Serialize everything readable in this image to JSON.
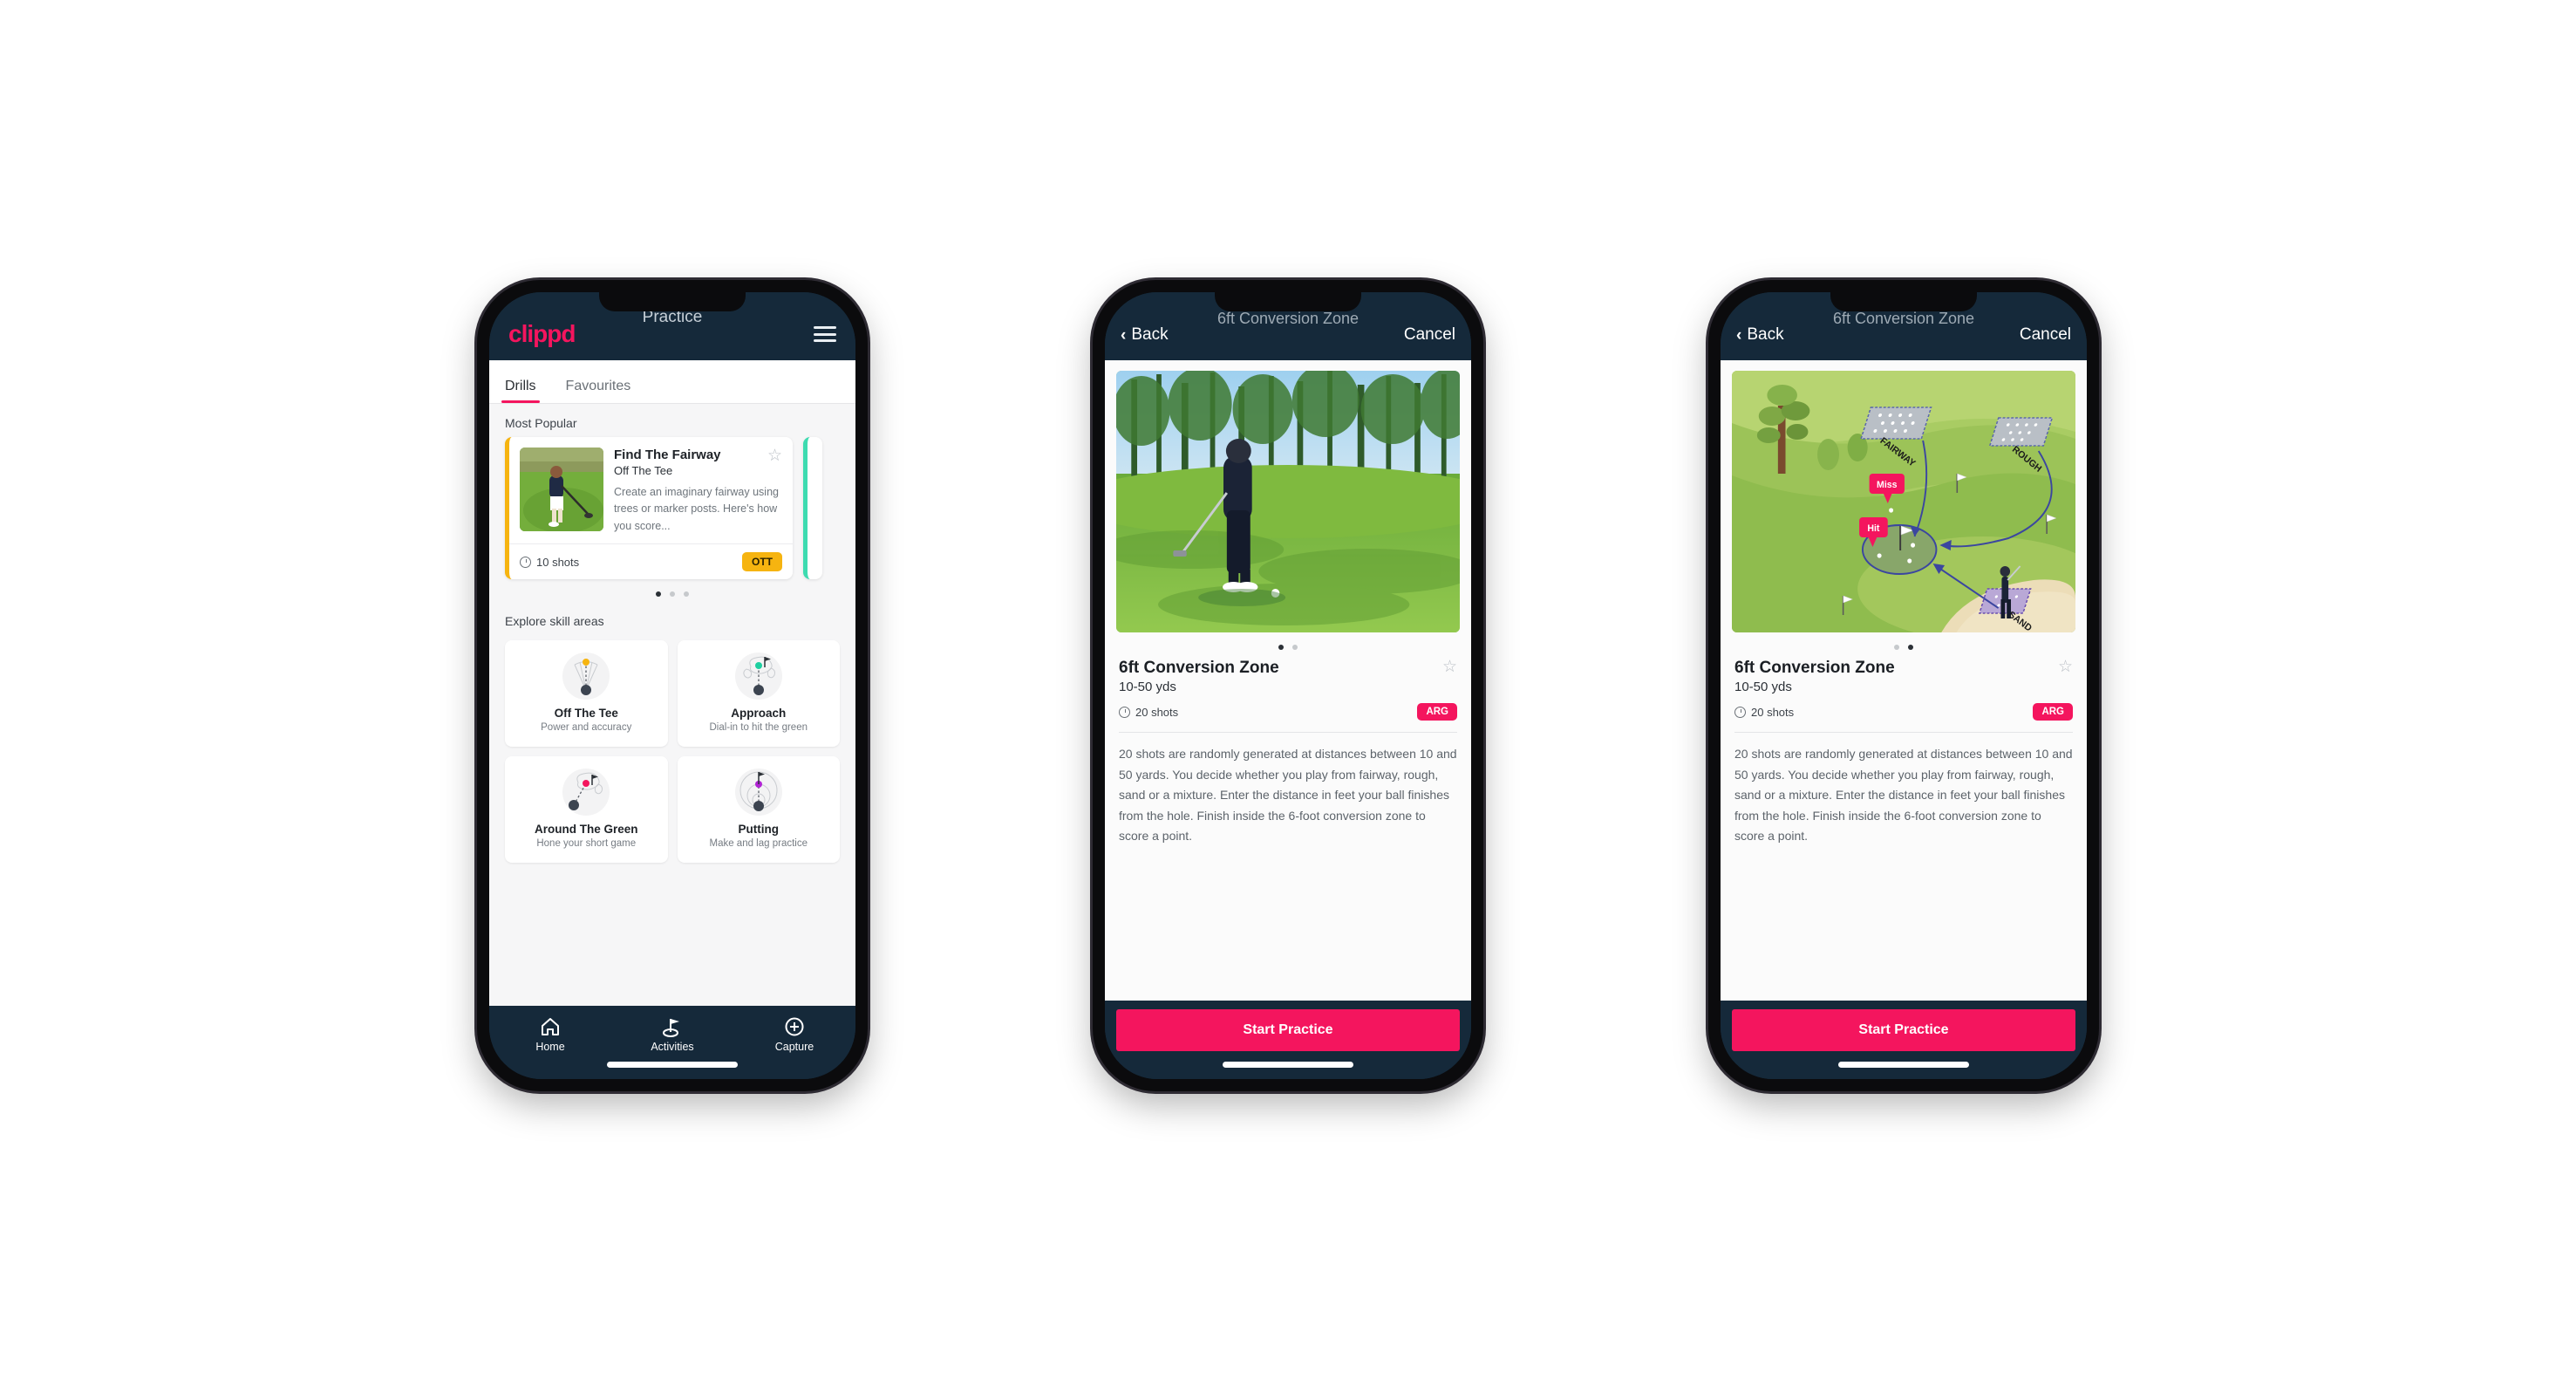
{
  "app": {
    "brand": "clippd",
    "accent_pink": "#f4155e",
    "dark_navy": "#15293a",
    "ott_yellow": "#f6b410",
    "teal": "#3ddbb0"
  },
  "phone1": {
    "appbar": {
      "title": "Practice",
      "menu_icon": "hamburger-icon"
    },
    "tabs": [
      {
        "label": "Drills",
        "active": true
      },
      {
        "label": "Favourites",
        "active": false
      }
    ],
    "sections": {
      "most_popular": "Most Popular",
      "explore": "Explore skill areas"
    },
    "drill_card": {
      "name": "Find The Fairway",
      "category": "Off The Tee",
      "description": "Create an imaginary fairway using trees or marker posts. Here's how you score...",
      "shots": "10 shots",
      "badge": "OTT",
      "star_icon": "star-outline-icon",
      "accent": "#f6b410"
    },
    "carousel_dots": [
      true,
      false,
      false
    ],
    "skills": [
      {
        "name": "Off The Tee",
        "desc": "Power and accuracy",
        "icon": "off-the-tee-icon",
        "dot": "#f6b410"
      },
      {
        "name": "Approach",
        "desc": "Dial-in to hit the green",
        "icon": "approach-icon",
        "dot": "#1ecfa0"
      },
      {
        "name": "Around The Green",
        "desc": "Hone your short game",
        "icon": "around-the-green-icon",
        "dot": "#f4155e"
      },
      {
        "name": "Putting",
        "desc": "Make and lag practice",
        "icon": "putting-icon",
        "dot": "#b124d4"
      }
    ],
    "tabbar": [
      {
        "label": "Home",
        "icon": "home-icon",
        "active": false
      },
      {
        "label": "Activities",
        "icon": "golf-flag-icon",
        "active": true
      },
      {
        "label": "Capture",
        "icon": "plus-circle-icon",
        "active": false
      }
    ]
  },
  "phone2": {
    "nav": {
      "back": "Back",
      "title": "6ft Conversion Zone",
      "cancel": "Cancel",
      "back_icon": "chevron-left-icon"
    },
    "media": "golfer-chipping-photo",
    "dots": [
      true,
      false
    ],
    "detail": {
      "title": "6ft Conversion Zone",
      "distance": "10-50 yds",
      "shots": "20 shots",
      "badge": "ARG",
      "star_icon": "star-outline-icon",
      "description": "20 shots are randomly generated at distances between 10 and 50 yards. You decide whether you play from fairway, rough, sand or a mixture. Enter the distance in feet your ball finishes from the hole. Finish inside the 6-foot conversion zone to score a point."
    },
    "cta": "Start Practice"
  },
  "phone3": {
    "nav": {
      "back": "Back",
      "title": "6ft Conversion Zone",
      "cancel": "Cancel",
      "back_icon": "chevron-left-icon"
    },
    "media": "course-diagram-illustration",
    "diagram_labels": {
      "fairway": "FAIRWAY",
      "rough": "ROUGH",
      "sand": "SAND",
      "miss": "Miss",
      "hit": "Hit"
    },
    "dots": [
      false,
      true
    ],
    "detail": {
      "title": "6ft Conversion Zone",
      "distance": "10-50 yds",
      "shots": "20 shots",
      "badge": "ARG",
      "star_icon": "star-outline-icon",
      "description": "20 shots are randomly generated at distances between 10 and 50 yards. You decide whether you play from fairway, rough, sand or a mixture. Enter the distance in feet your ball finishes from the hole. Finish inside the 6-foot conversion zone to score a point."
    },
    "cta": "Start Practice"
  }
}
